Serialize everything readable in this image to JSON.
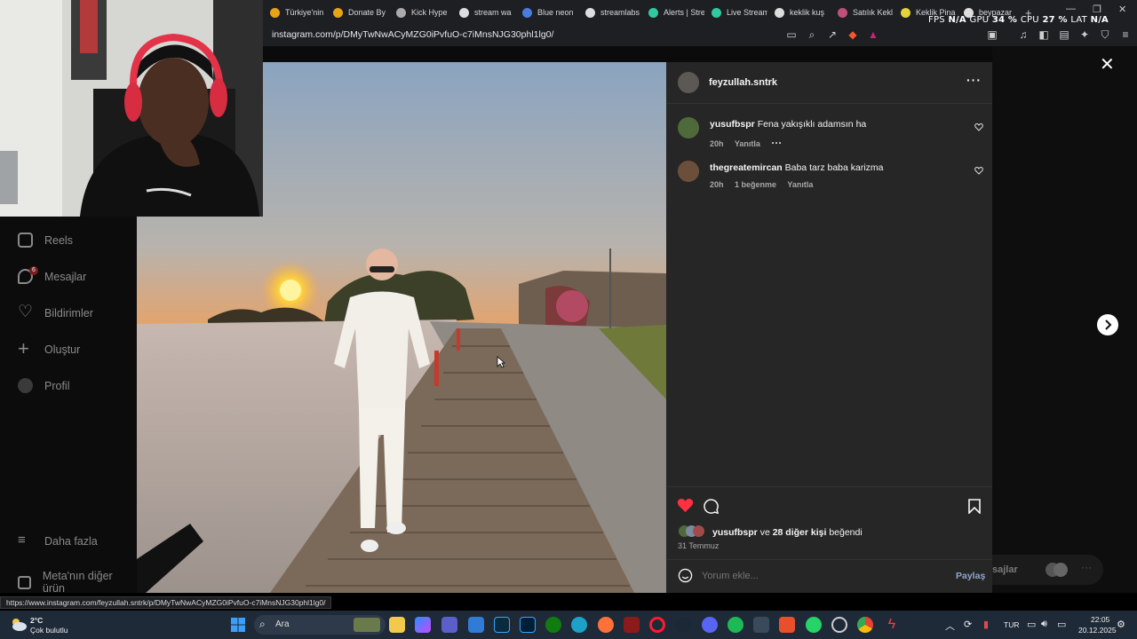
{
  "tabs": [
    {
      "label": "Türkiye'nin",
      "icon": "brand-icon",
      "color": "#e8a317"
    },
    {
      "label": "Donate By",
      "icon": "donate-icon",
      "color": "#e8a317"
    },
    {
      "label": "Kick Hype",
      "icon": "kick-icon",
      "color": "#aaaaaa"
    },
    {
      "label": "stream wa",
      "icon": "globe-icon",
      "color": "#dddddd"
    },
    {
      "label": "Blue neon",
      "icon": "doc-icon",
      "color": "#4a7be0"
    },
    {
      "label": "streamlabs",
      "icon": "globe-icon",
      "color": "#dddddd"
    },
    {
      "label": "Alerts | Stre",
      "icon": "alerts-icon",
      "color": "#30c9a0"
    },
    {
      "label": "Live Stream",
      "icon": "live-icon",
      "color": "#30c9a0"
    },
    {
      "label": "keklik kuş",
      "icon": "google-icon",
      "color": "#dddddd"
    },
    {
      "label": "Satılık Kekl",
      "icon": "listing-icon",
      "color": "#c0507a"
    },
    {
      "label": "Keklik Pina",
      "icon": "s-icon",
      "color": "#e6d23a"
    },
    {
      "label": "beypazar",
      "icon": "google-icon",
      "color": "#dddddd"
    }
  ],
  "overlay_stats": {
    "fps_label": "FPS",
    "fps_value": "N/A",
    "gpu_label": "GPU",
    "gpu_value": "34 %",
    "cpu_label": "CPU",
    "cpu_value": "27 %",
    "lat_label": "LAT",
    "lat_value": "N/A"
  },
  "url": "instagram.com/p/DMyTwNwACyMZG0iPvfuO-c7iMnsNJG30phl1lg0/",
  "sidebar": {
    "items": [
      {
        "label": "Reels",
        "icon": "reels-icon"
      },
      {
        "label": "Mesajlar",
        "icon": "messenger-icon",
        "badge": "6"
      },
      {
        "label": "Bildirimler",
        "icon": "heart-icon"
      },
      {
        "label": "Oluştur",
        "icon": "plus-icon"
      },
      {
        "label": "Profil",
        "icon": "profile-icon"
      }
    ],
    "more": "Daha fazla",
    "meta": "Meta'nın diğer ürün"
  },
  "post": {
    "author": "feyzullah.sntrk",
    "comments": [
      {
        "user": "yusufbspr",
        "text": "Fena yakışıklı adamsın ha",
        "time": "20h",
        "likes": "",
        "reply": "Yanıtla"
      },
      {
        "user": "thegreatemircan",
        "text": "Baba tarz baba karizma",
        "time": "20h",
        "likes": "1 beğenme",
        "reply": "Yanıtla"
      }
    ],
    "liked_by_user": "yusufbspr",
    "liked_by_rest": "ve",
    "liked_by_others": "28 diğer kişi",
    "liked_by_suffix": "beğendi",
    "date": "31 Temmuz",
    "comment_placeholder": "Yorum ekle...",
    "share_label": "Paylaş"
  },
  "messages_chip": "sajlar",
  "status_url": "https://www.instagram.com/feyzullah.sntrk/p/DMyTwNwACyMZG0iPvfuO-c7iMnsNJG30phl1lg0/",
  "taskbar": {
    "weather_temp": "2°C",
    "weather_desc": "Çok bulutlu",
    "search_placeholder": "Ara",
    "lang": "TUR",
    "time": "22:05",
    "date": "20.12.2025"
  }
}
